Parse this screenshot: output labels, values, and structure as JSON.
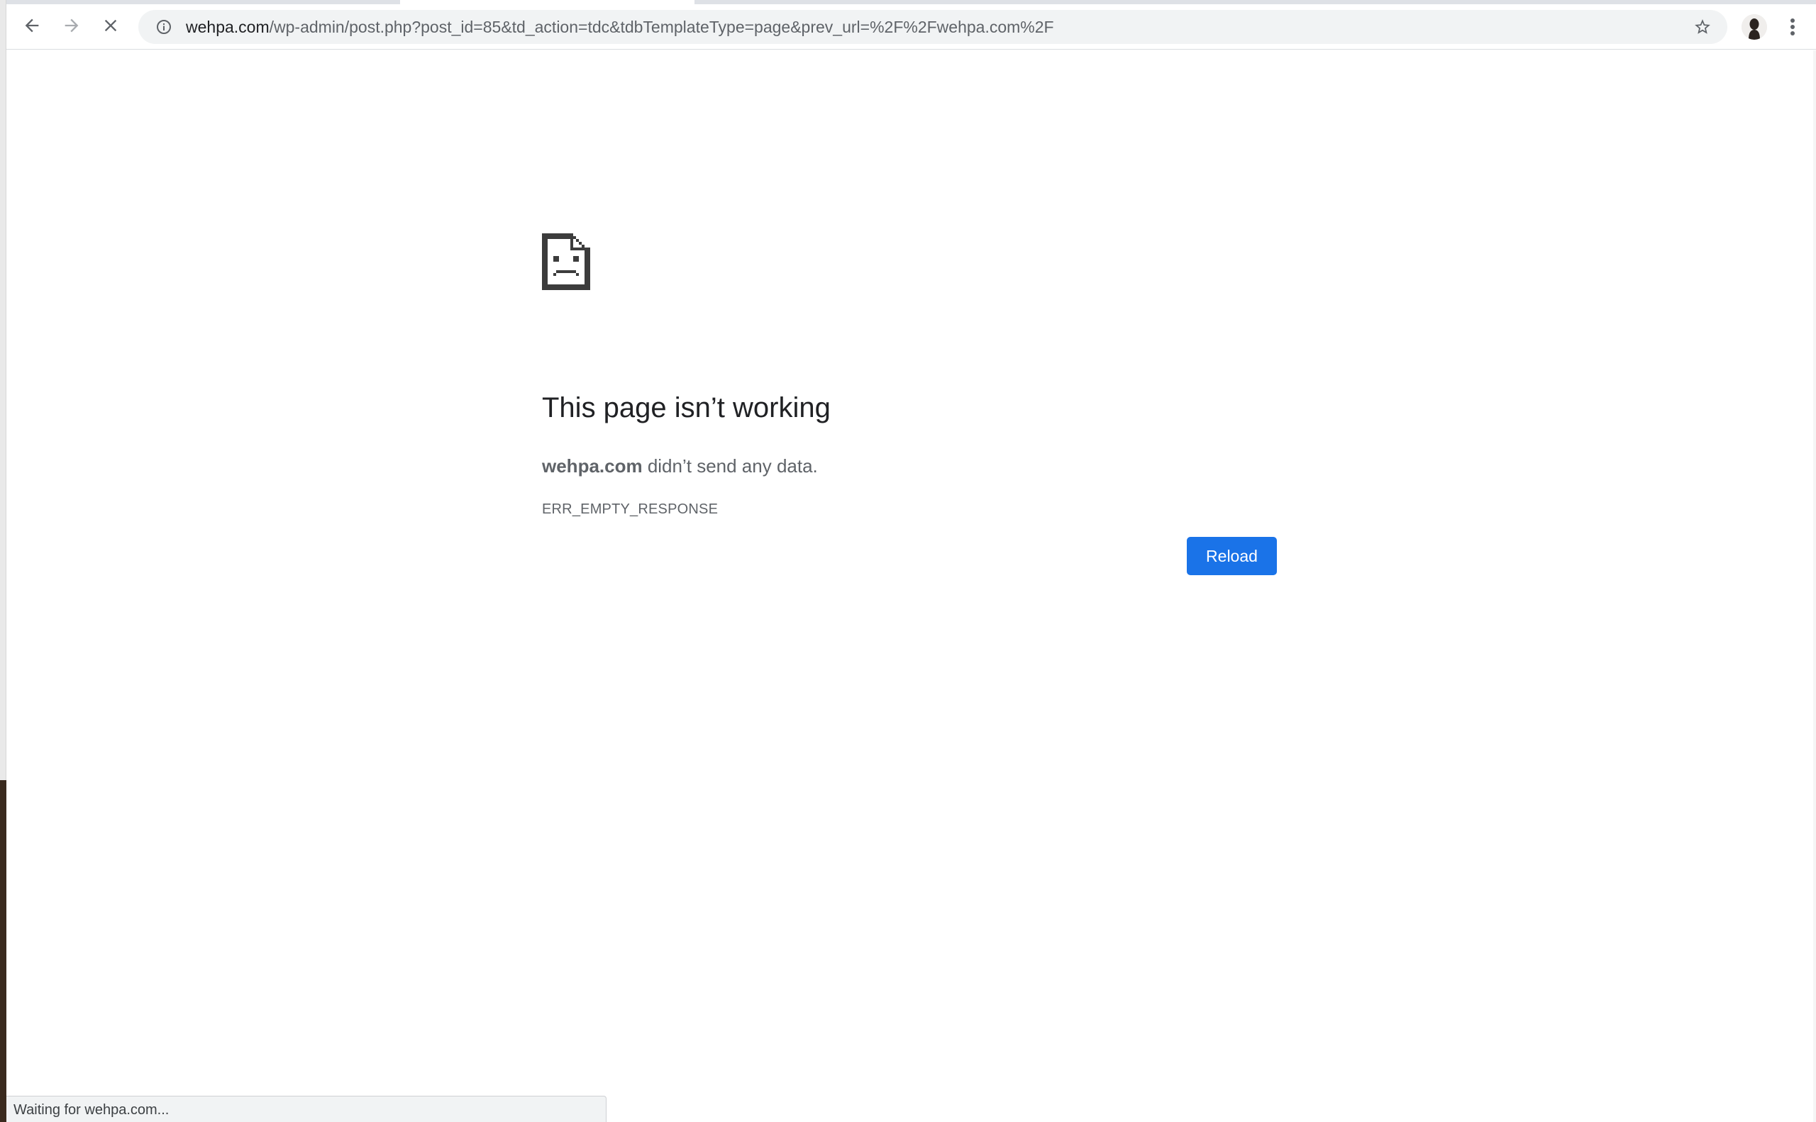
{
  "browser": {
    "url_host": "wehpa.com",
    "url_path": "/wp-admin/post.php?post_id=85&td_action=tdc&tdbTemplateType=page&prev_url=%2F%2Fwehpa.com%2F",
    "icons": {
      "back": "arrow-left-icon",
      "forward": "arrow-right-icon",
      "stop": "close-icon",
      "site_info": "info-icon",
      "bookmark": "star-icon",
      "profile": "avatar",
      "menu": "more-vert-icon"
    }
  },
  "error_page": {
    "icon": "sad-page-icon",
    "title": "This page isn’t working",
    "host": "wehpa.com",
    "description_rest": " didn’t send any data.",
    "code": "ERR_EMPTY_RESPONSE",
    "reload_label": "Reload"
  },
  "status_bar": {
    "text": "Waiting for wehpa.com..."
  },
  "colors": {
    "accent": "#1a73e8",
    "title": "#202124",
    "text": "#5f6368"
  }
}
